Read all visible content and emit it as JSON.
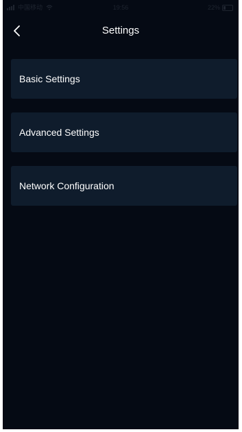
{
  "status_bar": {
    "carrier": "中国移动",
    "time": "19:56",
    "battery": "22%"
  },
  "header": {
    "title": "Settings",
    "back_icon": "chevron-left-icon"
  },
  "menu": {
    "items": [
      {
        "label": "Basic Settings"
      },
      {
        "label": "Advanced Settings"
      },
      {
        "label": "Network Configuration"
      }
    ]
  },
  "colors": {
    "background": "#050a14",
    "card": "#0f1c2c",
    "text": "#ffffff"
  }
}
